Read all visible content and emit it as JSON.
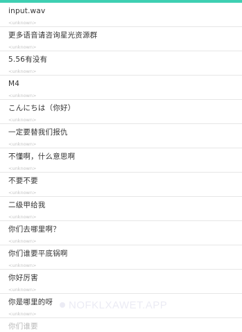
{
  "song_list": [
    {
      "title": "input.wav",
      "artist": "<unknown>"
    },
    {
      "title": "更多语音请咨询星光资源群",
      "artist": "<unknown>"
    },
    {
      "title": "5.56有没有",
      "artist": "<unknown>"
    },
    {
      "title": "M4",
      "artist": "<unknown>"
    },
    {
      "title": "こんにちは（你好）",
      "artist": "<unknown>"
    },
    {
      "title": "一定要替我们报仇",
      "artist": "<unknown>"
    },
    {
      "title": "不懂啊，什么意思啊",
      "artist": "<unknown>"
    },
    {
      "title": "不要不要",
      "artist": "<unknown>"
    },
    {
      "title": "二级甲给我",
      "artist": "<unknown>"
    },
    {
      "title": "你们去哪里啊？",
      "artist": "<unknown>"
    },
    {
      "title": "你们谁要平底锅啊",
      "artist": "<unknown>"
    },
    {
      "title": "你好厉害",
      "artist": "<unknown>"
    },
    {
      "title": "你是哪里的呀",
      "artist": "<unknown>"
    }
  ],
  "partial_item": {
    "title": "你们谁要"
  },
  "watermark": "NOFKLXAWET.APP",
  "colors": {
    "accent": "#3ecfb2",
    "title_text": "#333333",
    "artist_text": "#c4c4c4",
    "divider": "#e6e6e6"
  }
}
